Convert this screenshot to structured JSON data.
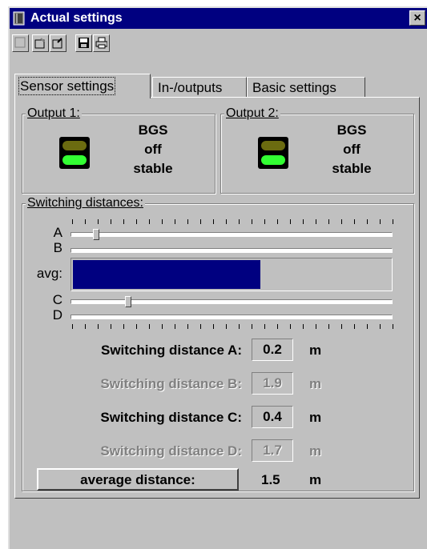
{
  "window": {
    "title": "Actual settings",
    "close_label": "×"
  },
  "toolbar": {
    "buttons": [
      "new-icon",
      "open-icon",
      "export-icon",
      "save-icon",
      "print-icon"
    ]
  },
  "tabs": [
    {
      "label": "Sensor settings",
      "active": true
    },
    {
      "label": "In-/outputs",
      "active": false
    },
    {
      "label": "Basic settings",
      "active": false
    }
  ],
  "outputs": [
    {
      "legend": "Output 1:",
      "line1": "BGS",
      "line2": "off",
      "line3": "stable"
    },
    {
      "legend": "Output 2:",
      "line1": "BGS",
      "line2": "off",
      "line3": "stable"
    }
  ],
  "led_colors": {
    "top": "#6b6b10",
    "bottom": "#33ff33"
  },
  "switching": {
    "legend": "Switching distances:",
    "sliders": [
      {
        "label": "A",
        "level": 0.07
      },
      {
        "label": "B",
        "level": 0.0
      },
      {
        "label": "C",
        "level": 0.17
      },
      {
        "label": "D",
        "level": 0.0
      }
    ],
    "avg_label": "avg:",
    "avg_fill": 0.59,
    "rows": [
      {
        "label": "Switching distance A:",
        "value": "0.2",
        "unit": "m",
        "enabled": true
      },
      {
        "label": "Switching distance B:",
        "value": "1.9",
        "unit": "m",
        "enabled": false
      },
      {
        "label": "Switching distance C:",
        "value": "0.4",
        "unit": "m",
        "enabled": true
      },
      {
        "label": "Switching distance D:",
        "value": "1.7",
        "unit": "m",
        "enabled": false
      }
    ],
    "average_button": "average distance:",
    "average_value": "1.5",
    "average_unit": "m"
  },
  "colors": {
    "face": "#c0c0c0",
    "title": "#000080",
    "avg_bar": "#000080"
  }
}
